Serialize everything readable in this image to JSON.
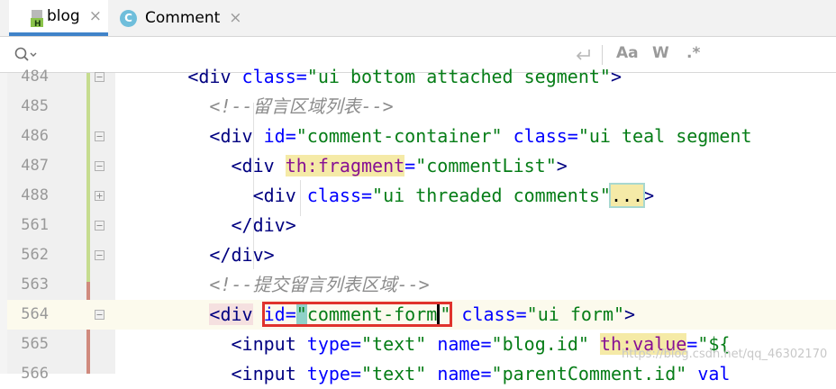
{
  "tabs": [
    {
      "label": "blog",
      "icon": "html-file-icon",
      "active": true,
      "close": "×"
    },
    {
      "label": "Comment",
      "icon": "class-c-icon",
      "icon_letter": "C",
      "active": false,
      "close": "×"
    }
  ],
  "find": {
    "placeholder": "",
    "match_case": "Aa",
    "words": "W",
    "regex": ".*"
  },
  "lines": [
    {
      "num": "484",
      "tokens": [
        {
          "t": "        ",
          "c": "text"
        },
        {
          "t": "<div ",
          "c": "tag"
        },
        {
          "t": "class=",
          "c": "attr"
        },
        {
          "t": "\"ui bottom attached segment\"",
          "c": "val"
        },
        {
          "t": ">",
          "c": "tag"
        }
      ]
    },
    {
      "num": "485",
      "tokens": [
        {
          "t": "          ",
          "c": "text"
        },
        {
          "t": "<!--留言区域列表-->",
          "c": "comment"
        }
      ]
    },
    {
      "num": "486",
      "tokens": [
        {
          "t": "          ",
          "c": "text"
        },
        {
          "t": "<div ",
          "c": "tag"
        },
        {
          "t": "id=",
          "c": "attr"
        },
        {
          "t": "\"comment-container\"",
          "c": "val"
        },
        {
          "t": " ",
          "c": "text"
        },
        {
          "t": "class=",
          "c": "attr"
        },
        {
          "t": "\"ui teal segment",
          "c": "val"
        }
      ]
    },
    {
      "num": "487",
      "tokens": [
        {
          "t": "            ",
          "c": "text"
        },
        {
          "t": "<div ",
          "c": "tag"
        },
        {
          "t": "th:fragment",
          "c": "th"
        },
        {
          "t": "=",
          "c": "attr"
        },
        {
          "t": "\"commentList\"",
          "c": "val"
        },
        {
          "t": ">",
          "c": "tag"
        }
      ]
    },
    {
      "num": "488",
      "tokens": [
        {
          "t": "              ",
          "c": "text"
        },
        {
          "t": "<div ",
          "c": "tag"
        },
        {
          "t": "class=",
          "c": "attr"
        },
        {
          "t": "\"ui threaded comments\"",
          "c": "val"
        },
        {
          "t": "...",
          "c": "dots"
        },
        {
          "t": ">",
          "c": "tag"
        }
      ]
    },
    {
      "num": "561",
      "tokens": [
        {
          "t": "            ",
          "c": "text"
        },
        {
          "t": "</div>",
          "c": "tag"
        }
      ]
    },
    {
      "num": "562",
      "tokens": [
        {
          "t": "          ",
          "c": "text"
        },
        {
          "t": "</div>",
          "c": "tag"
        }
      ]
    },
    {
      "num": "563",
      "tokens": [
        {
          "t": "          ",
          "c": "text"
        },
        {
          "t": "<!--提交留言列表区域-->",
          "c": "comment"
        }
      ]
    },
    {
      "num": "564",
      "current": true,
      "tokens": [
        {
          "t": "          ",
          "c": "text"
        },
        {
          "t": "<div",
          "c": "tag-hl"
        },
        {
          "t": " ",
          "c": "text"
        },
        {
          "t": "id=",
          "c": "attr-red-start"
        },
        {
          "t": "\"",
          "c": "quote-hl"
        },
        {
          "t": "comment-form",
          "c": "val-red"
        },
        {
          "t": "\"",
          "c": "quote-end-red"
        },
        {
          "t": " ",
          "c": "text"
        },
        {
          "t": "class=",
          "c": "attr"
        },
        {
          "t": "\"ui form\"",
          "c": "val"
        },
        {
          "t": ">",
          "c": "tag"
        }
      ]
    },
    {
      "num": "565",
      "tokens": [
        {
          "t": "            ",
          "c": "text"
        },
        {
          "t": "<input ",
          "c": "tag"
        },
        {
          "t": "type=",
          "c": "attr"
        },
        {
          "t": "\"text\"",
          "c": "val"
        },
        {
          "t": " ",
          "c": "text"
        },
        {
          "t": "name=",
          "c": "attr"
        },
        {
          "t": "\"blog.id\"",
          "c": "val"
        },
        {
          "t": " ",
          "c": "text"
        },
        {
          "t": "th:value",
          "c": "th"
        },
        {
          "t": "=",
          "c": "attr"
        },
        {
          "t": "\"${",
          "c": "val"
        }
      ]
    },
    {
      "num": "566",
      "tokens": [
        {
          "t": "            ",
          "c": "text"
        },
        {
          "t": "<input ",
          "c": "tag"
        },
        {
          "t": "type=",
          "c": "attr"
        },
        {
          "t": "\"text\"",
          "c": "val"
        },
        {
          "t": " ",
          "c": "text"
        },
        {
          "t": "name=",
          "c": "attr"
        },
        {
          "t": "\"parentComment.id\"",
          "c": "val"
        },
        {
          "t": " ",
          "c": "text"
        },
        {
          "t": "val",
          "c": "attr"
        }
      ]
    }
  ],
  "watermark": "https://blog.csdn.net/qq_46302170",
  "colors": {
    "tag": "#000080",
    "attr": "#0000ff",
    "value": "#067d17",
    "comment": "#8c8c8c",
    "thymeleaf": "#871094",
    "highlight_box": "#e0332d"
  }
}
